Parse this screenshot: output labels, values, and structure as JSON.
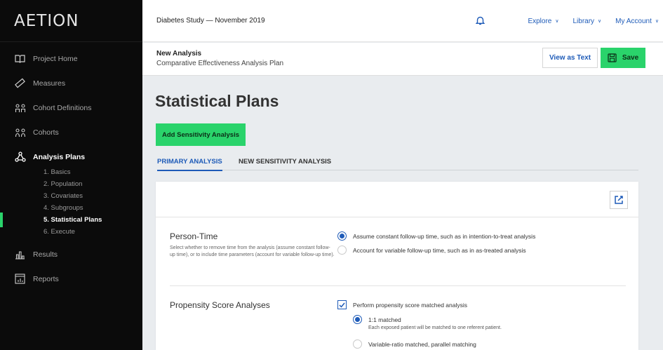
{
  "app": {
    "logo": "AETION"
  },
  "sidebar": {
    "items": [
      {
        "label": "Project Home",
        "icon": "book-icon"
      },
      {
        "label": "Measures",
        "icon": "ruler-icon"
      },
      {
        "label": "Cohort Definitions",
        "icon": "cohort-definitions-icon"
      },
      {
        "label": "Cohorts",
        "icon": "cohorts-icon"
      },
      {
        "label": "Analysis Plans",
        "icon": "analysis-plans-icon",
        "active": true
      },
      {
        "label": "Results",
        "icon": "bar-chart-icon"
      },
      {
        "label": "Reports",
        "icon": "report-icon"
      }
    ],
    "subitems": [
      {
        "label": "1. Basics"
      },
      {
        "label": "2. Population"
      },
      {
        "label": "3. Covariates"
      },
      {
        "label": "4. Subgroups"
      },
      {
        "label": "5. Statistical Plans",
        "active": true
      },
      {
        "label": "6. Execute"
      }
    ]
  },
  "topbar": {
    "study_title": "Diabetes Study — November 2019",
    "nav": {
      "explore": "Explore",
      "library": "Library",
      "account": "My Account"
    },
    "chevron": "∨"
  },
  "subheader": {
    "title": "New Analysis",
    "subtitle": "Comparative Effectiveness Analysis Plan",
    "view_as_text": "View as Text",
    "save": "Save"
  },
  "main": {
    "page_title": "Statistical Plans",
    "add_button": "Add Sensitivity Analysis",
    "tabs": [
      {
        "label": "PRIMARY ANALYSIS",
        "active": true
      },
      {
        "label": "NEW SENSITIVITY ANALYSIS"
      }
    ],
    "person_time": {
      "title": "Person-Time",
      "description": "Select whether to remove time from the analysis (assume constant follow-up time), or to include time parameters (account for variable follow-up time).",
      "options": [
        {
          "label": "Assume constant follow-up time, such as in intention-to-treat analysis",
          "selected": true
        },
        {
          "label": "Account for variable follow-up time, such as in as-treated analysis",
          "selected": false
        }
      ]
    },
    "propensity": {
      "title": "Propensity Score Analyses",
      "checkbox_label": "Perform propensity score matched analysis",
      "checked": true,
      "options": [
        {
          "label": "1:1 matched",
          "description": "Each exposed patient will be matched to one referent patient.",
          "selected": true
        },
        {
          "label": "Variable-ratio matched, parallel matching",
          "selected": false
        }
      ]
    }
  },
  "colors": {
    "accent_green": "#2ad36b",
    "link_blue": "#1e5bb8",
    "sidebar_bg": "#0b0b0b"
  }
}
